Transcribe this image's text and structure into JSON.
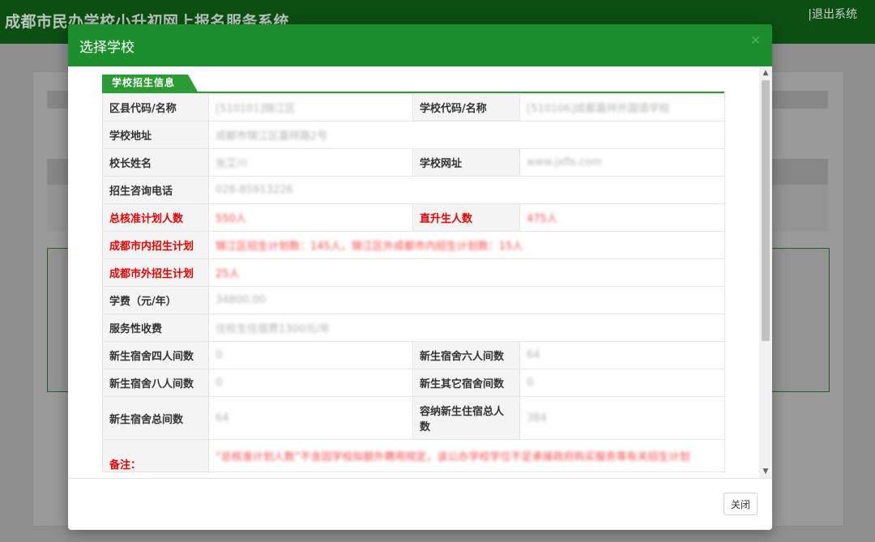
{
  "background": {
    "system_title": "成都市民办学校小升初网上报名服务系统",
    "logout_label": "|退出系统"
  },
  "modal": {
    "title": "选择学校",
    "close_icon": "×",
    "section_tag": "学校招生信息",
    "close_button": "关闭",
    "rows": [
      {
        "cells": [
          {
            "label": "区县代码/名称",
            "value": "[510101]锦江区"
          },
          {
            "label": "学校代码/名称",
            "value": "[510106]成都嘉祥外国语学校"
          }
        ]
      },
      {
        "cells": [
          {
            "label": "学校地址",
            "value": "成都市锦江区嘉祥路2号"
          }
        ]
      },
      {
        "cells": [
          {
            "label": "校长姓名",
            "value": "张艾川"
          },
          {
            "label": "学校网址",
            "value": "www.jxfls.com"
          }
        ]
      },
      {
        "cells": [
          {
            "label": "招生咨询电话",
            "value": "028-85913226"
          }
        ]
      },
      {
        "cells": [
          {
            "label": "总核准计划人数",
            "value": "550人",
            "highlight": true
          },
          {
            "label": "直升生人数",
            "value": "475人",
            "highlight": true
          }
        ]
      },
      {
        "cells": [
          {
            "label": "成都市内招生计划",
            "value": "锦江区招生计划数：145人，锦江区外成都市内招生计划数：15人",
            "highlight": true
          }
        ]
      },
      {
        "cells": [
          {
            "label": "成都市外招生计划",
            "value": "25人",
            "highlight": true
          }
        ]
      },
      {
        "cells": [
          {
            "label": "学费（元/年）",
            "value": "34800.00"
          }
        ]
      },
      {
        "cells": [
          {
            "label": "服务性收费",
            "value": "住校生住宿费1300元/年"
          }
        ]
      },
      {
        "cells": [
          {
            "label": "新生宿舍四人间数",
            "value": "0"
          },
          {
            "label": "新生宿舍六人间数",
            "value": "64"
          }
        ]
      },
      {
        "cells": [
          {
            "label": "新生宿舍八人间数",
            "value": "0"
          },
          {
            "label": "新生其它宿舍间数",
            "value": "0"
          }
        ]
      },
      {
        "cells": [
          {
            "label": "新生宿舍总间数",
            "value": "64"
          },
          {
            "label": "容纳新生住宿总人数",
            "value": "384"
          }
        ]
      },
      {
        "cells": [
          {
            "label": "备注：",
            "value": "“总核准计划人数”不含因学校拟额外聘用规定，该公办学校学位不足承接政府购买服务等有关招生计划",
            "highlight": true,
            "note": true
          }
        ]
      }
    ]
  },
  "colors": {
    "header_green": "#1c8f2c",
    "tag_green": "#2c9b33",
    "highlight_red": "#e60000"
  }
}
